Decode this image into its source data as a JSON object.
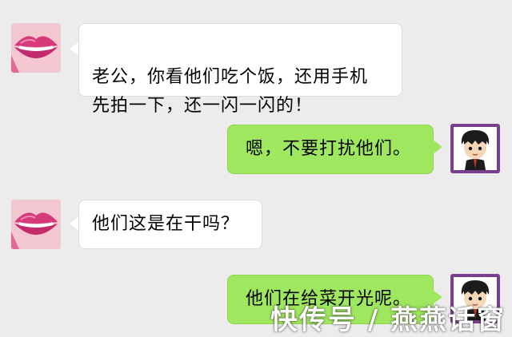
{
  "messages": [
    {
      "text": "老公，你看他们吃个饭，还用手机\n先拍一下，还一闪一闪的！"
    },
    {
      "text": "嗯，不要打扰他们。"
    },
    {
      "text": "他们这是在干吗？"
    },
    {
      "text": "他们在给菜开光呢。"
    }
  ],
  "watermark": "快传号 / 燕燕话窗",
  "colors": {
    "background": "#ececec",
    "left_bubble": "#ffffff",
    "right_bubble": "#9fe75e",
    "avatar_female_bg": "#f2b6c4",
    "avatar_male_bg": "#7a3e8e"
  },
  "icons": {
    "female_avatar": "pink-lips-avatar",
    "male_avatar": "cartoon-boy-avatar"
  }
}
